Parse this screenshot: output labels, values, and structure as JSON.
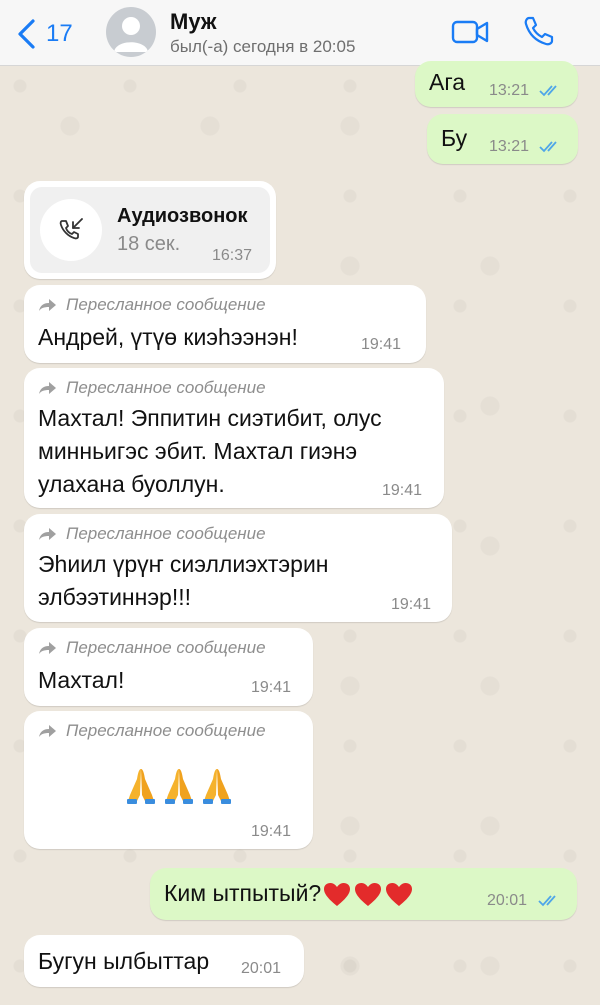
{
  "header": {
    "back_count": "17",
    "contact_name": "Муж",
    "status": "был(-а) сегодня в 20:05"
  },
  "messages": [
    {
      "dir": "out",
      "text": "Ага",
      "time": "13:21",
      "read": true
    },
    {
      "dir": "out",
      "text": "Бу",
      "time": "13:21",
      "read": true
    },
    {
      "dir": "in",
      "type": "call",
      "title": "Аудиозвонок",
      "duration": "18 сек.",
      "time": "16:37"
    },
    {
      "dir": "in",
      "forwarded": "Пересланное сообщение",
      "lines": [
        "Андрей, үтүө киэhээнэн!"
      ],
      "time": "19:41"
    },
    {
      "dir": "in",
      "forwarded": "Пересланное сообщение",
      "lines": [
        "Махтал! Эппитин сиэтибит, олус",
        "минньигэс эбит. Махтал гиэнэ",
        "улахана буоллун."
      ],
      "time": "19:41"
    },
    {
      "dir": "in",
      "forwarded": "Пересланное сообщение",
      "lines": [
        "Эhиил үрүҥ сиэллиэхтэрин",
        "элбээтиннэр!!!"
      ],
      "time": "19:41"
    },
    {
      "dir": "in",
      "forwarded": "Пересланное сообщение",
      "lines": [
        "Махтал!"
      ],
      "time": "19:41"
    },
    {
      "dir": "in",
      "forwarded": "Пересланное сообщение",
      "emoji": "🙏🙏🙏",
      "time": "19:41"
    },
    {
      "dir": "out",
      "text": "Ким ытпытый?",
      "emoji": "❤️❤️❤️",
      "time": "20:01",
      "read": true
    },
    {
      "dir": "in",
      "text": "Бугун ылбыттар",
      "time": "20:01"
    }
  ],
  "colors": {
    "accent": "#1a7cf5",
    "outgoing_bubble": "#dcf8c6",
    "incoming_bubble": "#ffffff",
    "read_ticks": "#4fa6e8",
    "chat_background": "#ece6dc"
  },
  "icons": [
    "chevron-left-icon",
    "avatar-placeholder-icon",
    "video-call-icon",
    "phone-icon",
    "missed-incoming-call-icon",
    "forward-arrow-icon",
    "double-check-icon",
    "folded-hands-emoji",
    "red-heart-emoji"
  ]
}
